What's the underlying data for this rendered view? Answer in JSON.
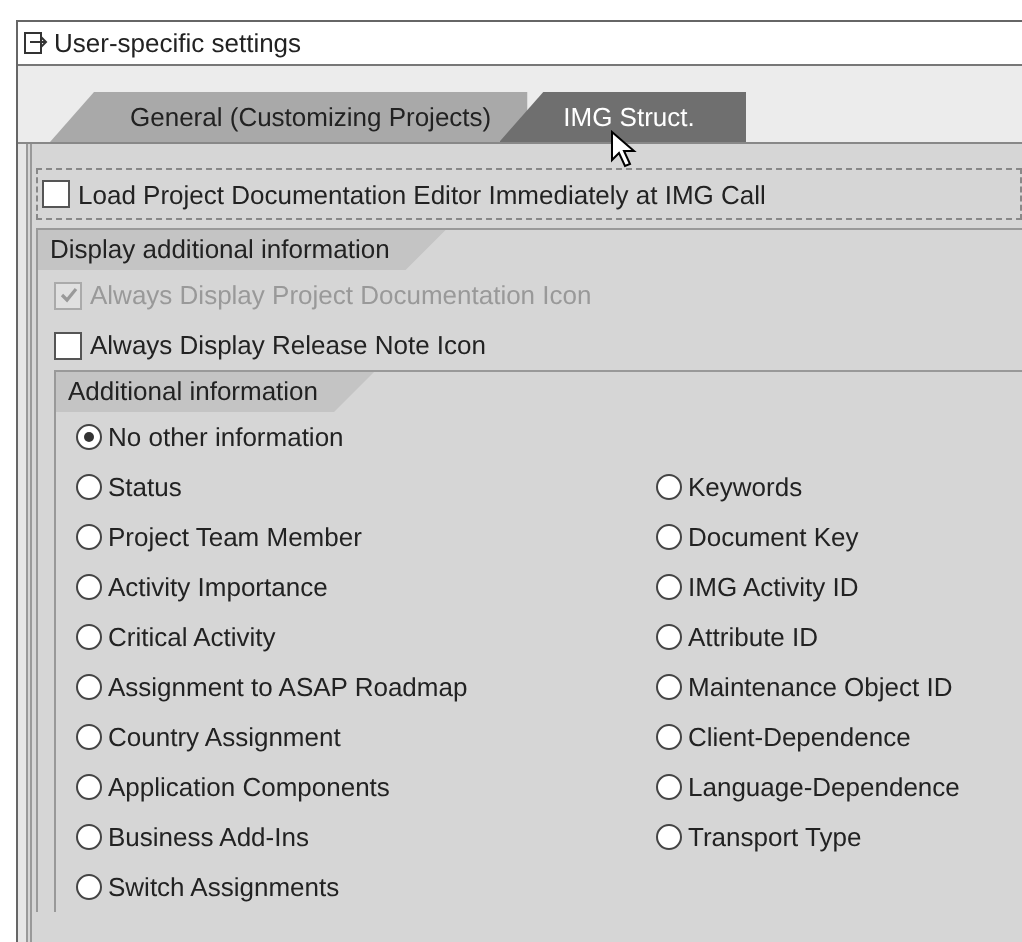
{
  "window": {
    "title": "User-specific settings"
  },
  "tabs": [
    {
      "label": "General (Customizing Projects)",
      "selected": false
    },
    {
      "label": "IMG Struct.",
      "selected": true
    }
  ],
  "load_editor": {
    "label": "Load Project Documentation Editor Immediately at IMG Call",
    "checked": false,
    "disabled": false
  },
  "display_group": {
    "title": "Display additional information",
    "checkboxes": [
      {
        "label": "Always Display Project Documentation Icon",
        "checked": true,
        "disabled": true
      },
      {
        "label": "Always Display Release Note Icon",
        "checked": false,
        "disabled": false
      }
    ]
  },
  "additional_group": {
    "title": "Additional information",
    "rows": [
      [
        {
          "label": "No other information",
          "selected": true
        }
      ],
      [
        {
          "label": "Status",
          "selected": false
        },
        {
          "label": "Keywords",
          "selected": false
        }
      ],
      [
        {
          "label": "Project Team Member",
          "selected": false
        },
        {
          "label": "Document Key",
          "selected": false
        }
      ],
      [
        {
          "label": "Activity Importance",
          "selected": false
        },
        {
          "label": "IMG Activity ID",
          "selected": false
        }
      ],
      [
        {
          "label": "Critical Activity",
          "selected": false
        },
        {
          "label": "Attribute ID",
          "selected": false
        }
      ],
      [
        {
          "label": "Assignment to ASAP Roadmap",
          "selected": false
        },
        {
          "label": "Maintenance Object ID",
          "selected": false
        }
      ],
      [
        {
          "label": "Country Assignment",
          "selected": false
        },
        {
          "label": "Client-Dependence",
          "selected": false
        }
      ],
      [
        {
          "label": "Application Components",
          "selected": false
        },
        {
          "label": "Language-Dependence",
          "selected": false
        }
      ],
      [
        {
          "label": "Business Add-Ins",
          "selected": false
        },
        {
          "label": "Transport Type",
          "selected": false
        }
      ],
      [
        {
          "label": "Switch Assignments",
          "selected": false
        }
      ]
    ]
  }
}
